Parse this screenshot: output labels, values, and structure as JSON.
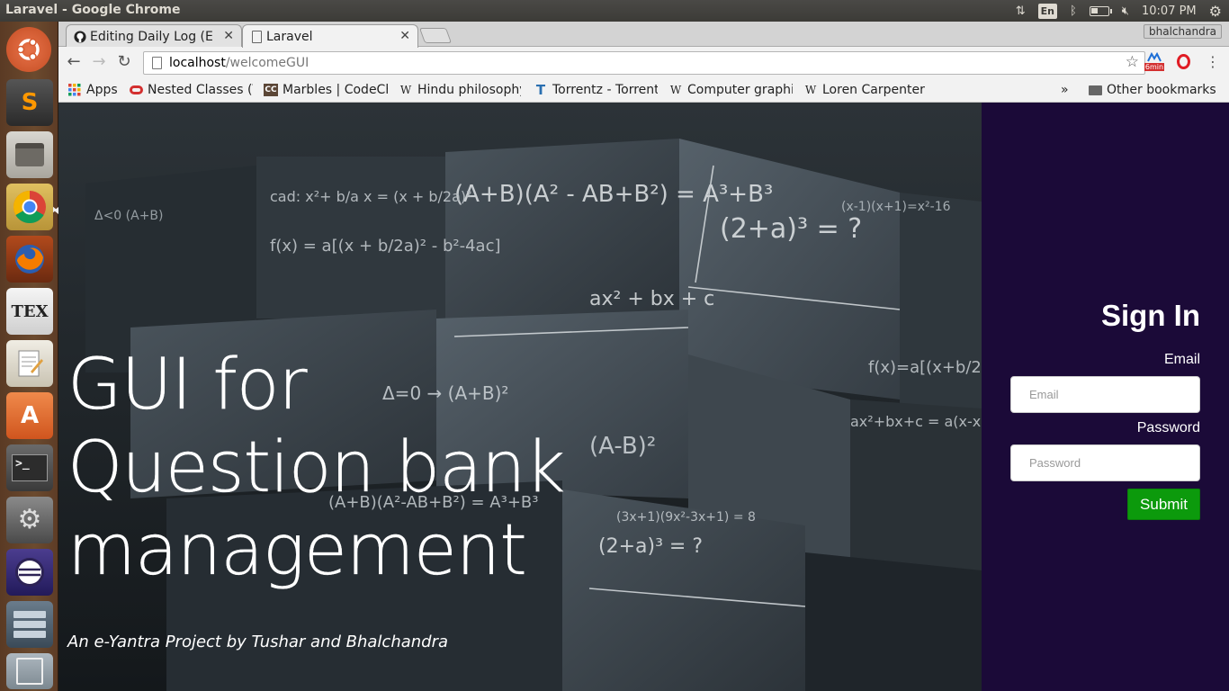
{
  "system_panel": {
    "window_title": "Laravel - Google Chrome",
    "input_language": "En",
    "clock": "10:07 PM",
    "battery_level": 0.45
  },
  "launcher": {
    "items": [
      {
        "name": "ubuntu-dash-icon"
      },
      {
        "name": "sublime-text-icon",
        "glyph": "S"
      },
      {
        "name": "file-manager-icon"
      },
      {
        "name": "chrome-icon",
        "active": true
      },
      {
        "name": "firefox-icon"
      },
      {
        "name": "texmaker-icon",
        "glyph": "TEX"
      },
      {
        "name": "text-editor-icon"
      },
      {
        "name": "software-center-icon",
        "glyph": "A"
      },
      {
        "name": "terminal-icon",
        "glyph": ">_"
      },
      {
        "name": "system-settings-icon"
      },
      {
        "name": "eclipse-icon"
      },
      {
        "name": "workspace-switcher-icon"
      }
    ]
  },
  "browser": {
    "tabs": [
      {
        "title": "Editing Daily Log (E",
        "favicon": "github-icon",
        "active": false
      },
      {
        "title": "Laravel",
        "favicon": "page-icon",
        "active": true
      }
    ],
    "profile_name": "bhalchandra",
    "url_host": "localhost",
    "url_path": "/welcomeGUI",
    "extension_badge": "6min",
    "bookmarks": [
      {
        "label": "Apps",
        "icon": "apps-grid-icon"
      },
      {
        "label": "Nested Classes (T",
        "icon": "oracle-icon"
      },
      {
        "label": "Marbles | CodeCh",
        "icon": "codechef-icon"
      },
      {
        "label": "Hindu philosophy",
        "icon": "wikipedia-icon"
      },
      {
        "label": "Torrentz - Torrent",
        "icon": "torrentz-icon"
      },
      {
        "label": "Computer graphi",
        "icon": "wikipedia-icon"
      },
      {
        "label": "Loren Carpenter",
        "icon": "wikipedia-icon"
      }
    ],
    "other_bookmarks": "Other bookmarks"
  },
  "hero": {
    "title": "GUI for Question bank management",
    "subtitle": "An e-Yantra Project by Tushar and Bhalchandra"
  },
  "signin": {
    "title": "Sign In",
    "email_label": "Email",
    "email_placeholder": "Email",
    "password_label": "Password",
    "password_placeholder": "Password",
    "submit_label": "Submit",
    "accent_color": "#0c9a0c",
    "panel_color": "#1b0a38"
  }
}
